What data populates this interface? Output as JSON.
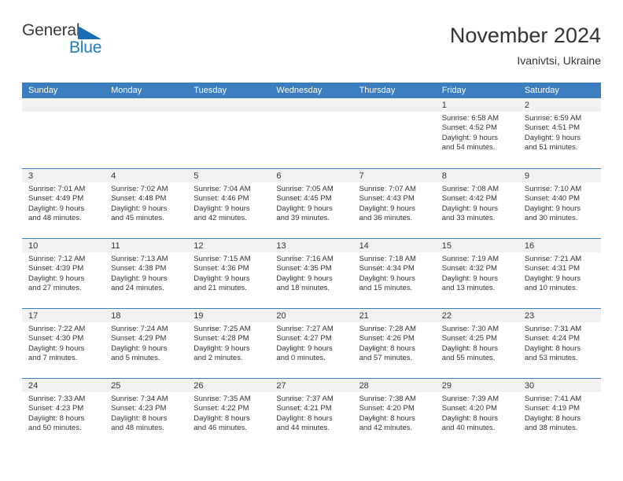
{
  "brand": {
    "name_top": "General",
    "name_bottom": "Blue",
    "accent_color": "#1f7cc4",
    "triangle_color": "#1a6cb5"
  },
  "header": {
    "title": "November 2024",
    "subtitle": "Ivanivtsi, Ukraine"
  },
  "calendar": {
    "header_bg": "#3b7dbf",
    "weekdays": [
      "Sunday",
      "Monday",
      "Tuesday",
      "Wednesday",
      "Thursday",
      "Friday",
      "Saturday"
    ],
    "weeks": [
      [
        {
          "day": "",
          "empty": true
        },
        {
          "day": "",
          "empty": true
        },
        {
          "day": "",
          "empty": true
        },
        {
          "day": "",
          "empty": true
        },
        {
          "day": "",
          "empty": true
        },
        {
          "day": "1",
          "sunrise": "Sunrise: 6:58 AM",
          "sunset": "Sunset: 4:52 PM",
          "daylight1": "Daylight: 9 hours",
          "daylight2": "and 54 minutes."
        },
        {
          "day": "2",
          "sunrise": "Sunrise: 6:59 AM",
          "sunset": "Sunset: 4:51 PM",
          "daylight1": "Daylight: 9 hours",
          "daylight2": "and 51 minutes."
        }
      ],
      [
        {
          "day": "3",
          "sunrise": "Sunrise: 7:01 AM",
          "sunset": "Sunset: 4:49 PM",
          "daylight1": "Daylight: 9 hours",
          "daylight2": "and 48 minutes."
        },
        {
          "day": "4",
          "sunrise": "Sunrise: 7:02 AM",
          "sunset": "Sunset: 4:48 PM",
          "daylight1": "Daylight: 9 hours",
          "daylight2": "and 45 minutes."
        },
        {
          "day": "5",
          "sunrise": "Sunrise: 7:04 AM",
          "sunset": "Sunset: 4:46 PM",
          "daylight1": "Daylight: 9 hours",
          "daylight2": "and 42 minutes."
        },
        {
          "day": "6",
          "sunrise": "Sunrise: 7:05 AM",
          "sunset": "Sunset: 4:45 PM",
          "daylight1": "Daylight: 9 hours",
          "daylight2": "and 39 minutes."
        },
        {
          "day": "7",
          "sunrise": "Sunrise: 7:07 AM",
          "sunset": "Sunset: 4:43 PM",
          "daylight1": "Daylight: 9 hours",
          "daylight2": "and 36 minutes."
        },
        {
          "day": "8",
          "sunrise": "Sunrise: 7:08 AM",
          "sunset": "Sunset: 4:42 PM",
          "daylight1": "Daylight: 9 hours",
          "daylight2": "and 33 minutes."
        },
        {
          "day": "9",
          "sunrise": "Sunrise: 7:10 AM",
          "sunset": "Sunset: 4:40 PM",
          "daylight1": "Daylight: 9 hours",
          "daylight2": "and 30 minutes."
        }
      ],
      [
        {
          "day": "10",
          "sunrise": "Sunrise: 7:12 AM",
          "sunset": "Sunset: 4:39 PM",
          "daylight1": "Daylight: 9 hours",
          "daylight2": "and 27 minutes."
        },
        {
          "day": "11",
          "sunrise": "Sunrise: 7:13 AM",
          "sunset": "Sunset: 4:38 PM",
          "daylight1": "Daylight: 9 hours",
          "daylight2": "and 24 minutes."
        },
        {
          "day": "12",
          "sunrise": "Sunrise: 7:15 AM",
          "sunset": "Sunset: 4:36 PM",
          "daylight1": "Daylight: 9 hours",
          "daylight2": "and 21 minutes."
        },
        {
          "day": "13",
          "sunrise": "Sunrise: 7:16 AM",
          "sunset": "Sunset: 4:35 PM",
          "daylight1": "Daylight: 9 hours",
          "daylight2": "and 18 minutes."
        },
        {
          "day": "14",
          "sunrise": "Sunrise: 7:18 AM",
          "sunset": "Sunset: 4:34 PM",
          "daylight1": "Daylight: 9 hours",
          "daylight2": "and 15 minutes."
        },
        {
          "day": "15",
          "sunrise": "Sunrise: 7:19 AM",
          "sunset": "Sunset: 4:32 PM",
          "daylight1": "Daylight: 9 hours",
          "daylight2": "and 13 minutes."
        },
        {
          "day": "16",
          "sunrise": "Sunrise: 7:21 AM",
          "sunset": "Sunset: 4:31 PM",
          "daylight1": "Daylight: 9 hours",
          "daylight2": "and 10 minutes."
        }
      ],
      [
        {
          "day": "17",
          "sunrise": "Sunrise: 7:22 AM",
          "sunset": "Sunset: 4:30 PM",
          "daylight1": "Daylight: 9 hours",
          "daylight2": "and 7 minutes."
        },
        {
          "day": "18",
          "sunrise": "Sunrise: 7:24 AM",
          "sunset": "Sunset: 4:29 PM",
          "daylight1": "Daylight: 9 hours",
          "daylight2": "and 5 minutes."
        },
        {
          "day": "19",
          "sunrise": "Sunrise: 7:25 AM",
          "sunset": "Sunset: 4:28 PM",
          "daylight1": "Daylight: 9 hours",
          "daylight2": "and 2 minutes."
        },
        {
          "day": "20",
          "sunrise": "Sunrise: 7:27 AM",
          "sunset": "Sunset: 4:27 PM",
          "daylight1": "Daylight: 9 hours",
          "daylight2": "and 0 minutes."
        },
        {
          "day": "21",
          "sunrise": "Sunrise: 7:28 AM",
          "sunset": "Sunset: 4:26 PM",
          "daylight1": "Daylight: 8 hours",
          "daylight2": "and 57 minutes."
        },
        {
          "day": "22",
          "sunrise": "Sunrise: 7:30 AM",
          "sunset": "Sunset: 4:25 PM",
          "daylight1": "Daylight: 8 hours",
          "daylight2": "and 55 minutes."
        },
        {
          "day": "23",
          "sunrise": "Sunrise: 7:31 AM",
          "sunset": "Sunset: 4:24 PM",
          "daylight1": "Daylight: 8 hours",
          "daylight2": "and 53 minutes."
        }
      ],
      [
        {
          "day": "24",
          "sunrise": "Sunrise: 7:33 AM",
          "sunset": "Sunset: 4:23 PM",
          "daylight1": "Daylight: 8 hours",
          "daylight2": "and 50 minutes."
        },
        {
          "day": "25",
          "sunrise": "Sunrise: 7:34 AM",
          "sunset": "Sunset: 4:23 PM",
          "daylight1": "Daylight: 8 hours",
          "daylight2": "and 48 minutes."
        },
        {
          "day": "26",
          "sunrise": "Sunrise: 7:35 AM",
          "sunset": "Sunset: 4:22 PM",
          "daylight1": "Daylight: 8 hours",
          "daylight2": "and 46 minutes."
        },
        {
          "day": "27",
          "sunrise": "Sunrise: 7:37 AM",
          "sunset": "Sunset: 4:21 PM",
          "daylight1": "Daylight: 8 hours",
          "daylight2": "and 44 minutes."
        },
        {
          "day": "28",
          "sunrise": "Sunrise: 7:38 AM",
          "sunset": "Sunset: 4:20 PM",
          "daylight1": "Daylight: 8 hours",
          "daylight2": "and 42 minutes."
        },
        {
          "day": "29",
          "sunrise": "Sunrise: 7:39 AM",
          "sunset": "Sunset: 4:20 PM",
          "daylight1": "Daylight: 8 hours",
          "daylight2": "and 40 minutes."
        },
        {
          "day": "30",
          "sunrise": "Sunrise: 7:41 AM",
          "sunset": "Sunset: 4:19 PM",
          "daylight1": "Daylight: 8 hours",
          "daylight2": "and 38 minutes."
        }
      ]
    ]
  }
}
